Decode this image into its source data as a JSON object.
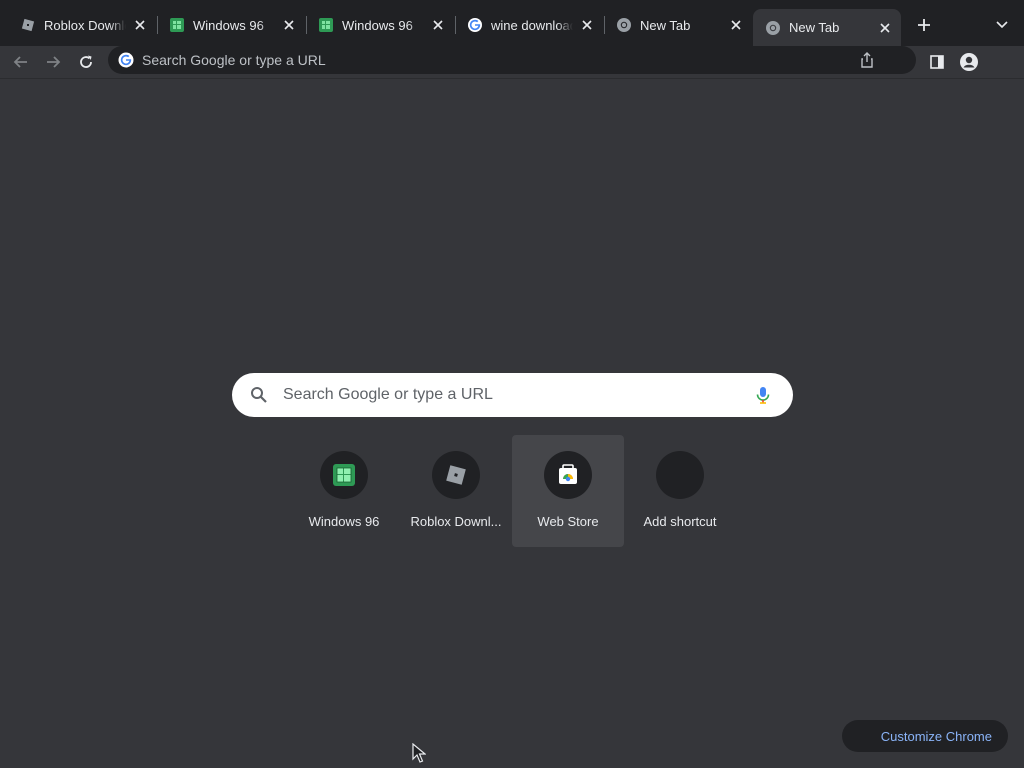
{
  "tabs": [
    {
      "title": "Roblox Download",
      "favicon": "roblox-icon",
      "active": false
    },
    {
      "title": "Windows 96",
      "favicon": "windows96-icon",
      "active": false
    },
    {
      "title": "Windows 96",
      "favicon": "windows96-icon",
      "active": false
    },
    {
      "title": "wine download",
      "favicon": "google-icon",
      "active": false
    },
    {
      "title": "New Tab",
      "favicon": "chrome-icon",
      "active": false
    },
    {
      "title": "New Tab",
      "favicon": "chrome-icon",
      "active": true
    }
  ],
  "toolbar": {
    "omnibox_placeholder": "Search Google or type a URL"
  },
  "ntp": {
    "search_placeholder": "Search Google or type a URL",
    "shortcuts": [
      {
        "label": "Windows 96",
        "icon": "windows96-icon"
      },
      {
        "label": "Roblox Downl...",
        "icon": "roblox-icon"
      },
      {
        "label": "Web Store",
        "icon": "web-store-icon"
      },
      {
        "label": "Add shortcut",
        "icon": "add-icon"
      }
    ],
    "customize_label": "Customize Chrome"
  },
  "colors": {
    "frame": "#202124",
    "background": "#35363a",
    "accent": "#8ab4f8"
  }
}
